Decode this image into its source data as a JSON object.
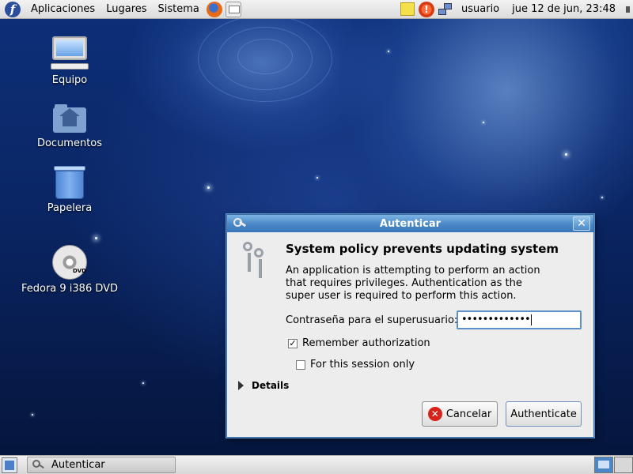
{
  "top_panel": {
    "menus": [
      "Aplicaciones",
      "Lugares",
      "Sistema"
    ],
    "launchers": [
      "firefox-icon",
      "mail-icon"
    ],
    "tray": [
      "notes-icon",
      "update-icon",
      "network-icon",
      "volume-icon"
    ],
    "user": "usuario",
    "clock": "jue 12 de jun, 23:48"
  },
  "desktop": {
    "icons": [
      {
        "label": "Equipo",
        "icon": "computer-icon"
      },
      {
        "label": "Documentos",
        "icon": "home-folder-icon"
      },
      {
        "label": "Papelera",
        "icon": "trash-icon"
      },
      {
        "label": "Fedora 9 i386 DVD",
        "icon": "dvd-icon",
        "badge": "DVD"
      }
    ]
  },
  "dialog": {
    "title": "Autenticar",
    "heading": "System policy prevents updating system",
    "body": "An application is attempting to perform an action that requires privileges. Authentication as the super user is required to perform this action.",
    "password_label": "Contraseña para el superusuario:",
    "password_value": "•••••••••••••",
    "remember_label": "Remember authorization",
    "remember_checked": true,
    "session_label": "For this session only",
    "session_checked": false,
    "details_label": "Details",
    "cancel_label": "Cancelar",
    "auth_label": "Authenticate",
    "colors": {
      "titlebar": "#4a87c6",
      "cancel_icon": "#d8231a"
    }
  },
  "bottom_panel": {
    "task": "Autenticar",
    "workspaces": [
      "active",
      "inactive"
    ]
  }
}
